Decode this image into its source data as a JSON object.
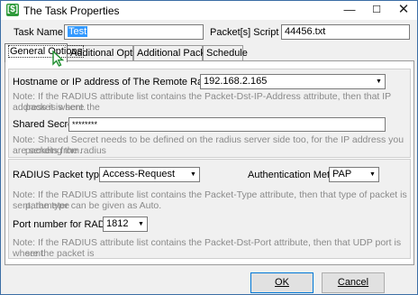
{
  "window": {
    "title": "The Task Properties",
    "app_icon_glyph": "[$]",
    "minimize_glyph": "—",
    "maximize_glyph": "☐",
    "close_glyph": "✕"
  },
  "header": {
    "task_name_label": "Task Name:",
    "task_name_value": "Test",
    "script_file_label": "Packet[s] Script File:",
    "script_file_value": "44456.txt"
  },
  "tabs": [
    {
      "label": "General Options",
      "active": true
    },
    {
      "label": "Additional Options",
      "active": false
    },
    {
      "label": "Additional Packets",
      "active": false
    },
    {
      "label": "Schedule",
      "active": false
    }
  ],
  "general": {
    "hostname_label": "Hostname or IP address of The Remote Radius Server:",
    "hostname_value": "192.168.2.165",
    "hostname_note_1": "Note: If the RADIUS attribute list contains the Packet-Dst-IP-Address attribute, then that IP address is where the",
    "hostname_note_2": "packet is sent.",
    "secret_label": "Shared Secret:",
    "secret_value": "********",
    "secret_note_1": "Note: Shared Secret needs to be defined on the radius server side too, for the IP address you are sending the radius",
    "secret_note_2": "packets from.",
    "packet_type_label": "RADIUS Packet types::",
    "packet_type_value": "Access-Request",
    "auth_method_label": "Authentication Method:",
    "auth_method_value": "PAP",
    "packet_type_note_1": "Note: If the RADIUS attribute list contains the Packet-Type attribute, then that type of packet is sent, the type",
    "packet_type_note_2": "parameter can be given as Auto.",
    "port_label": "Port number for RADIUS:",
    "port_value": "1812",
    "port_note_1": "Note:  If the RADIUS attribute list contains the Packet-Dst-Port attribute, then that  UDP port is where the packet is",
    "port_note_2": "sent."
  },
  "buttons": {
    "ok_label": "OK",
    "cancel_label": "Cancel"
  },
  "colors": {
    "selection": "#3399ff",
    "default_button_border": "#0078d7",
    "app_icon": "#2e9a3a"
  }
}
